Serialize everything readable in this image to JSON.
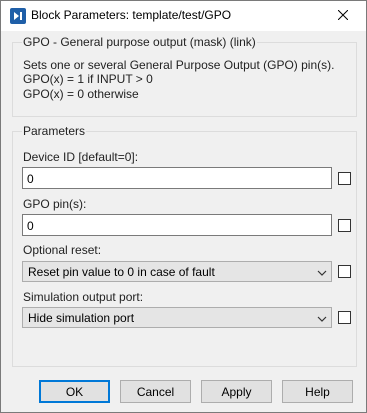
{
  "window": {
    "title": "Block Parameters: template/test/GPO"
  },
  "description": {
    "group_title": "GPO - General purpose output (mask) (link)",
    "lines": [
      "Sets one or several General Purpose Output (GPO) pin(s).",
      "GPO(x) = 1 if INPUT > 0",
      "GPO(x) = 0 otherwise"
    ]
  },
  "parameters": {
    "group_title": "Parameters",
    "device_id": {
      "label": "Device ID [default=0]:",
      "value": "0"
    },
    "gpo_pins": {
      "label": "GPO pin(s):",
      "value": "0"
    },
    "optional_reset": {
      "label": "Optional reset:",
      "value": "Reset pin value to 0 in case of fault"
    },
    "sim_output_port": {
      "label": "Simulation output port:",
      "value": "Hide simulation port"
    }
  },
  "buttons": {
    "ok": "OK",
    "cancel": "Cancel",
    "apply": "Apply",
    "help": "Help"
  },
  "colors": {
    "default_button_border": "#0078d7",
    "app_icon": "#1f5fa8"
  }
}
